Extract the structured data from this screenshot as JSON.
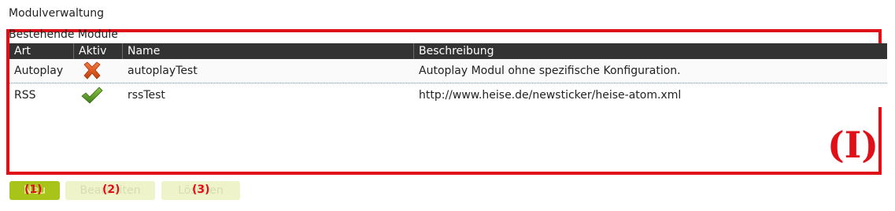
{
  "page": {
    "title": "Modulverwaltung"
  },
  "section": {
    "title": "Bestehende Module"
  },
  "grid": {
    "columns": [
      "Art",
      "Aktiv",
      "Name",
      "Beschreibung"
    ],
    "rows": [
      {
        "art": "Autoplay",
        "aktiv_icon": "cross-icon",
        "name": "autoplayTest",
        "description": "Autoplay Modul ohne spezifische Konfiguration."
      },
      {
        "art": "RSS",
        "aktiv_icon": "check-icon",
        "name": "rssTest",
        "description": "http://www.heise.de/newsticker/heise-atom.xml"
      }
    ]
  },
  "annotations": {
    "region_label": "(I)",
    "button_markers": [
      "(1)",
      "(2)",
      "(3)"
    ]
  },
  "buttons": {
    "new_label": "Neu",
    "edit_label": "Bearbeiten",
    "delete_label": "Löschen"
  },
  "colors": {
    "annotation": "#e01018",
    "header_bg": "#333333",
    "button_active": "#a8c41a",
    "button_disabled": "#eef3c9"
  }
}
